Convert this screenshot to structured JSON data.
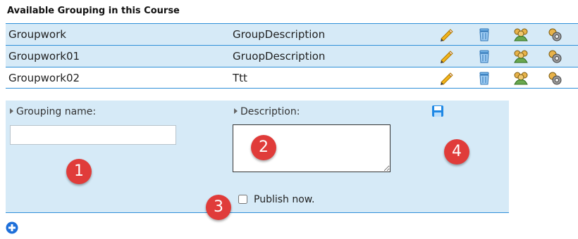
{
  "title": "Available Grouping in this Course",
  "groupings": [
    {
      "name": "Groupwork",
      "description": "GroupDescription"
    },
    {
      "name": "Groupwork01",
      "description": "GruopDescription"
    },
    {
      "name": "Groupwork02",
      "description": "Ttt"
    }
  ],
  "form": {
    "name_label": "Grouping name:",
    "name_value": "",
    "description_label": "Description:",
    "description_value": "",
    "publish_label": "Publish now.",
    "publish_checked": false
  },
  "markers": [
    "1",
    "2",
    "3",
    "4"
  ],
  "icons": {
    "edit": "pencil-icon",
    "delete": "trash-icon",
    "members": "group-icon",
    "settings": "settings-icon",
    "save": "save-icon",
    "add": "add-icon"
  },
  "colors": {
    "accent": "#2e8fd8",
    "row_shade": "#d6eaf7",
    "marker": "#e03c3a"
  }
}
